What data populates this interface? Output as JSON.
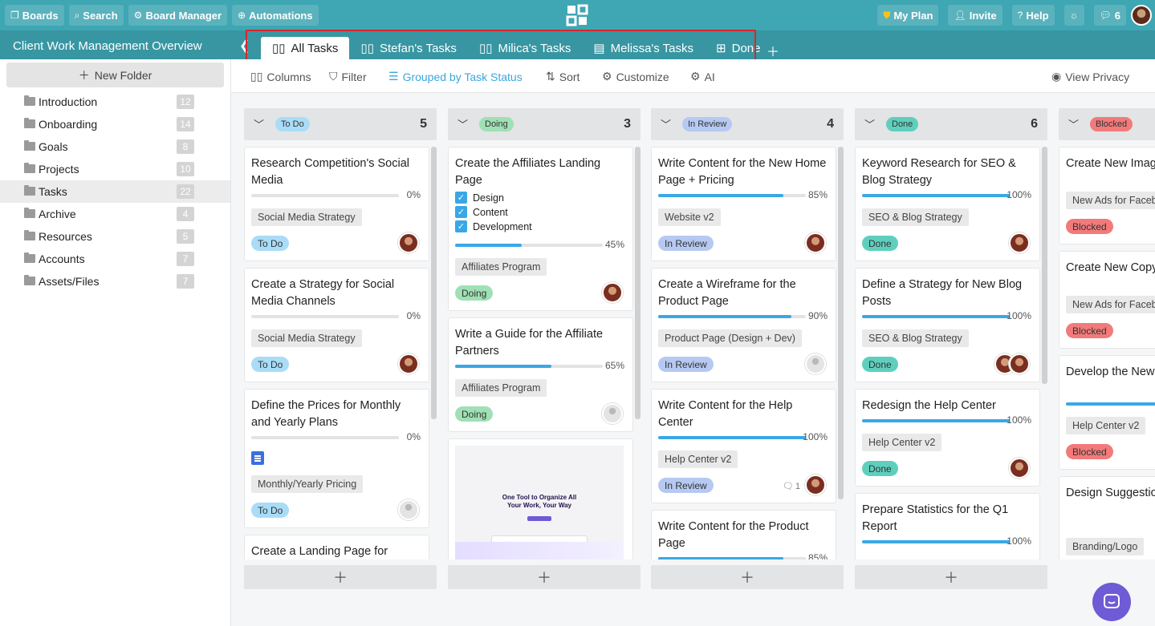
{
  "topbar": {
    "boards": "Boards",
    "search": "Search",
    "board_manager": "Board Manager",
    "automations": "Automations",
    "my_plan": "My Plan",
    "invite": "Invite",
    "help": "Help",
    "notifications_count": "6"
  },
  "subbar": {
    "title": "Client Work Management Overview",
    "tabs": [
      "All Tasks",
      "Stefan's Tasks",
      "Milica's Tasks",
      "Melissa's Tasks",
      "Done"
    ]
  },
  "sidebar": {
    "new_folder": "New Folder",
    "folders": [
      {
        "name": "Introduction",
        "count": "12"
      },
      {
        "name": "Onboarding",
        "count": "14"
      },
      {
        "name": "Goals",
        "count": "8"
      },
      {
        "name": "Projects",
        "count": "10"
      },
      {
        "name": "Tasks",
        "count": "22"
      },
      {
        "name": "Archive",
        "count": "4"
      },
      {
        "name": "Resources",
        "count": "5"
      },
      {
        "name": "Accounts",
        "count": "7"
      },
      {
        "name": "Assets/Files",
        "count": "7"
      }
    ]
  },
  "toolbar": {
    "columns": "Columns",
    "filter": "Filter",
    "grouped": "Grouped by Task Status",
    "sort": "Sort",
    "customize": "Customize",
    "ai": "AI",
    "view_privacy": "View Privacy"
  },
  "colors": {
    "todo": "#a9dcf7",
    "doing": "#9fe0b5",
    "review": "#b6c9f2",
    "done": "#5fcfbd",
    "blocked": "#f27a7a"
  },
  "columns": [
    {
      "label": "To Do",
      "count": "5",
      "cards": [
        {
          "title": "Research Competition's Social Media",
          "pct": "0%",
          "tag": "Social Media Strategy",
          "status": "To Do"
        },
        {
          "title": "Create a Strategy for Social Media Channels",
          "pct": "0%",
          "tag": "Social Media Strategy",
          "status": "To Do"
        },
        {
          "title": "Define the Prices for Monthly and Yearly Plans",
          "pct": "0%",
          "tag": "Monthly/Yearly Pricing",
          "status": "To Do"
        },
        {
          "title": "Create a Landing Page for"
        }
      ]
    },
    {
      "label": "Doing",
      "count": "3",
      "cards": [
        {
          "title": "Create the Affiliates Landing Page",
          "checklist": [
            "Design",
            "Content",
            "Development"
          ],
          "pct": "45%",
          "tag": "Affiliates Program",
          "status": "Doing"
        },
        {
          "title": "Write a Guide for the Affiliate Partners",
          "pct": "65%",
          "tag": "Affiliates Program",
          "status": "Doing"
        },
        {
          "thumb_headline": "One Tool to Organize All Your Work, Your Way"
        }
      ]
    },
    {
      "label": "In Review",
      "count": "4",
      "cards": [
        {
          "title": "Write Content for the New Home Page + Pricing",
          "pct": "85%",
          "tag": "Website v2",
          "status": "In Review"
        },
        {
          "title": "Create a Wireframe for the Product Page",
          "pct": "90%",
          "tag": "Product Page (Design + Dev)",
          "status": "In Review"
        },
        {
          "title": "Write Content for the Help Center",
          "pct": "100%",
          "tag": "Help Center v2",
          "status": "In Review",
          "comments": "1"
        },
        {
          "title": "Write Content for the Product Page",
          "pct": "85%"
        }
      ]
    },
    {
      "label": "Done",
      "count": "6",
      "cards": [
        {
          "title": "Keyword Research for SEO & Blog Strategy",
          "pct": "100%",
          "tag": "SEO & Blog Strategy",
          "status": "Done"
        },
        {
          "title": "Define a Strategy for New Blog Posts",
          "pct": "100%",
          "tag": "SEO & Blog Strategy",
          "status": "Done"
        },
        {
          "title": "Redesign the Help Center",
          "pct": "100%",
          "tag": "Help Center v2",
          "status": "Done"
        },
        {
          "title": "Prepare Statistics for the Q1 Report",
          "pct": "100%"
        }
      ]
    },
    {
      "label": "Blocked",
      "cards": [
        {
          "title": "Create New Imag",
          "tag": "New Ads for Faceb",
          "status": "Blocked"
        },
        {
          "title": "Create New Copy",
          "tag": "New Ads for Faceb",
          "status": "Blocked"
        },
        {
          "title": "Develop the New Platform",
          "tag": "Help Center v2",
          "status": "Blocked"
        },
        {
          "title": "Design Suggestio Logo",
          "tag": "Branding/Logo"
        }
      ]
    }
  ]
}
